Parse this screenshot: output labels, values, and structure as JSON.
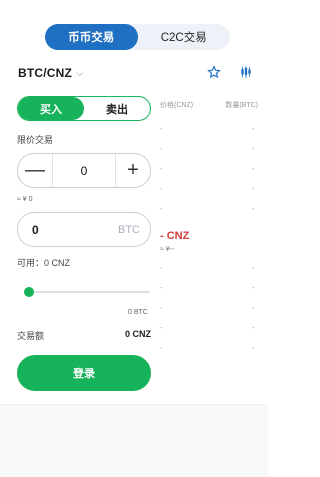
{
  "tabs": [
    {
      "label": "币币交易",
      "active": true
    },
    {
      "label": "C2C交易",
      "active": false
    }
  ],
  "pair": {
    "name": "BTC/CNZ",
    "caret": "⌵"
  },
  "icons": {
    "star": "star-icon",
    "kline": "candlestick-chart-icon"
  },
  "side_toggle": {
    "buy": "买入",
    "sell": "卖出"
  },
  "order_type": "限价交易",
  "price": {
    "minus": "—",
    "value": "0",
    "plus": "+"
  },
  "price_cny": "≈ ¥ 0",
  "amount": {
    "value": "0",
    "unit": "BTC"
  },
  "available": "可用：0 CNZ",
  "slider": {
    "max_label": "0 BTC",
    "level": 0
  },
  "trade_amount": {
    "label": "交易额",
    "value": "0 CNZ"
  },
  "login_label": "登录",
  "orderbook": {
    "price_header": "价格(CNZ)",
    "qty_header": "数量(BTC)",
    "row_placeholder": "-",
    "mid_price": "- CNZ",
    "mid_cny": "≈ ¥--"
  },
  "colors": {
    "accent_blue": "#1f6fc3",
    "buy_green": "#17b35a",
    "price_red": "#d23c3c"
  }
}
